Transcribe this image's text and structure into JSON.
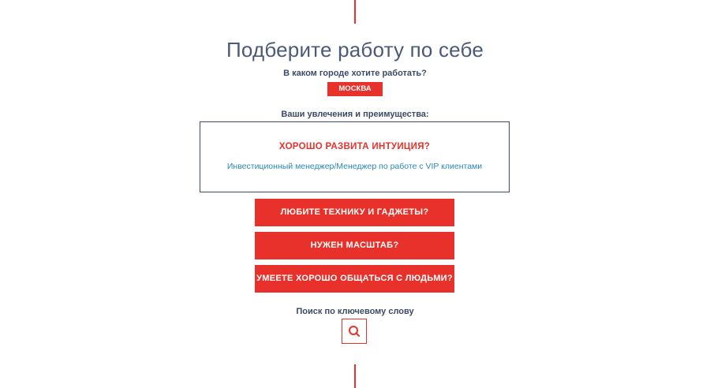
{
  "header": {
    "title": "Подберите работу по себе"
  },
  "city": {
    "question": "В каком городе хотите работать?",
    "selected": "МОСКВА"
  },
  "hobbies": {
    "label": "Ваши увлечения и преимущества:",
    "active_card": {
      "question": "ХОРОШО РАЗВИТА ИНТУИЦИЯ?",
      "link": "Инвестиционный менеджер/Менеджер по работе с VIP клиентами"
    },
    "options": [
      {
        "label": "ЛЮБИТЕ ТЕХНИКУ И ГАДЖЕТЫ?"
      },
      {
        "label": "НУЖЕН МАСШТАБ?"
      },
      {
        "label": "УМЕЕТЕ ХОРОШО ОБЩАТЬСЯ С ЛЮДЬМИ?"
      }
    ]
  },
  "search": {
    "label": "Поиск по ключевому слову",
    "icon": "search-icon"
  },
  "colors": {
    "accent": "#e8312a",
    "text_dark": "#3d4a66",
    "link": "#2a88b8"
  }
}
